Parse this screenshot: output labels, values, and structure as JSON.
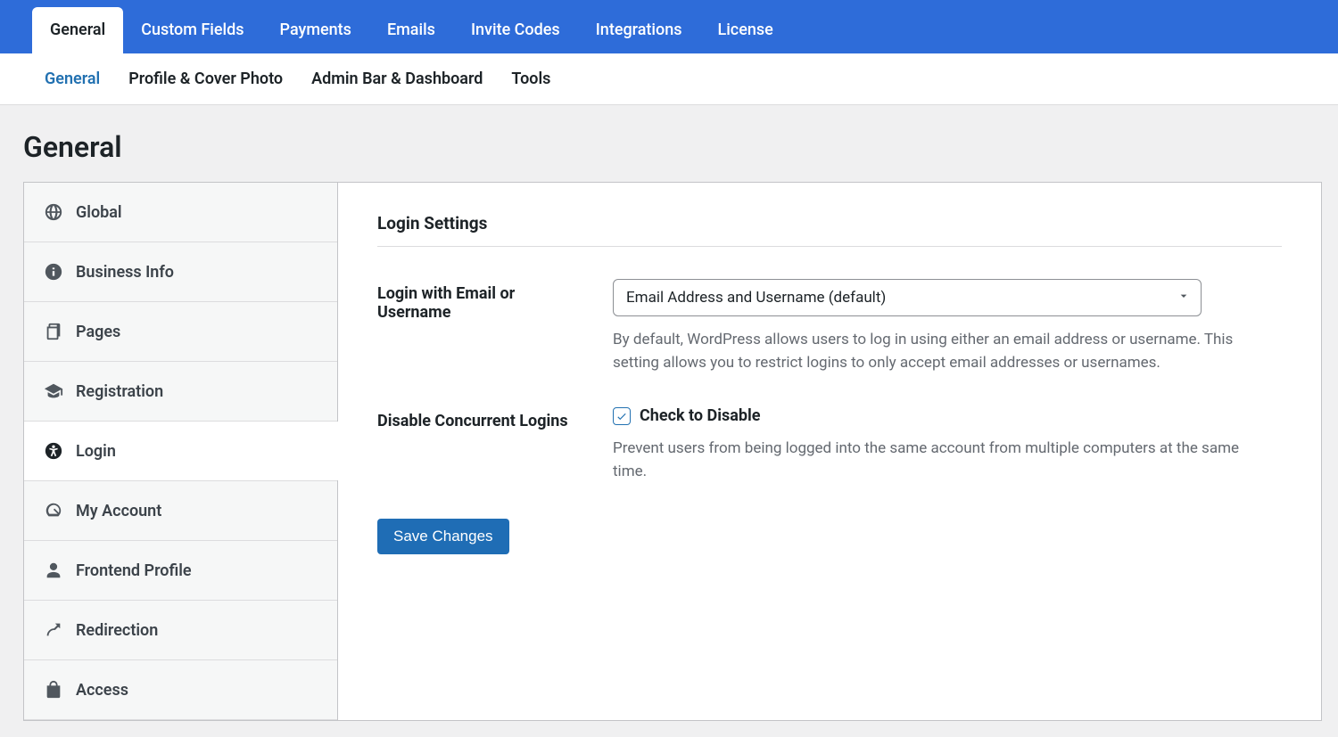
{
  "topTabs": [
    {
      "label": "General",
      "active": true
    },
    {
      "label": "Custom Fields",
      "active": false
    },
    {
      "label": "Payments",
      "active": false
    },
    {
      "label": "Emails",
      "active": false
    },
    {
      "label": "Invite Codes",
      "active": false
    },
    {
      "label": "Integrations",
      "active": false
    },
    {
      "label": "License",
      "active": false
    }
  ],
  "subTabs": [
    {
      "label": "General",
      "active": true
    },
    {
      "label": "Profile & Cover Photo",
      "active": false
    },
    {
      "label": "Admin Bar & Dashboard",
      "active": false
    },
    {
      "label": "Tools",
      "active": false
    }
  ],
  "pageTitle": "General",
  "sidebar": [
    {
      "label": "Global",
      "icon": "globe-icon",
      "active": false
    },
    {
      "label": "Business Info",
      "icon": "info-icon",
      "active": false
    },
    {
      "label": "Pages",
      "icon": "pages-icon",
      "active": false
    },
    {
      "label": "Registration",
      "icon": "graduation-icon",
      "active": false
    },
    {
      "label": "Login",
      "icon": "accessibility-icon",
      "active": true
    },
    {
      "label": "My Account",
      "icon": "dashboard-icon",
      "active": false
    },
    {
      "label": "Frontend Profile",
      "icon": "user-icon",
      "active": false
    },
    {
      "label": "Redirection",
      "icon": "redirect-icon",
      "active": false
    },
    {
      "label": "Access",
      "icon": "bag-icon",
      "active": false
    }
  ],
  "section": {
    "title": "Login Settings",
    "loginMethod": {
      "label": "Login with Email or Username",
      "selected": "Email Address and Username (default)",
      "description": "By default, WordPress allows users to log in using either an email address or username. This setting allows you to restrict logins to only accept email addresses or usernames."
    },
    "disableConcurrent": {
      "label": "Disable Concurrent Logins",
      "checkboxLabel": "Check to Disable",
      "checked": true,
      "description": "Prevent users from being logged into the same account from multiple computers at the same time."
    },
    "saveLabel": "Save Changes"
  }
}
